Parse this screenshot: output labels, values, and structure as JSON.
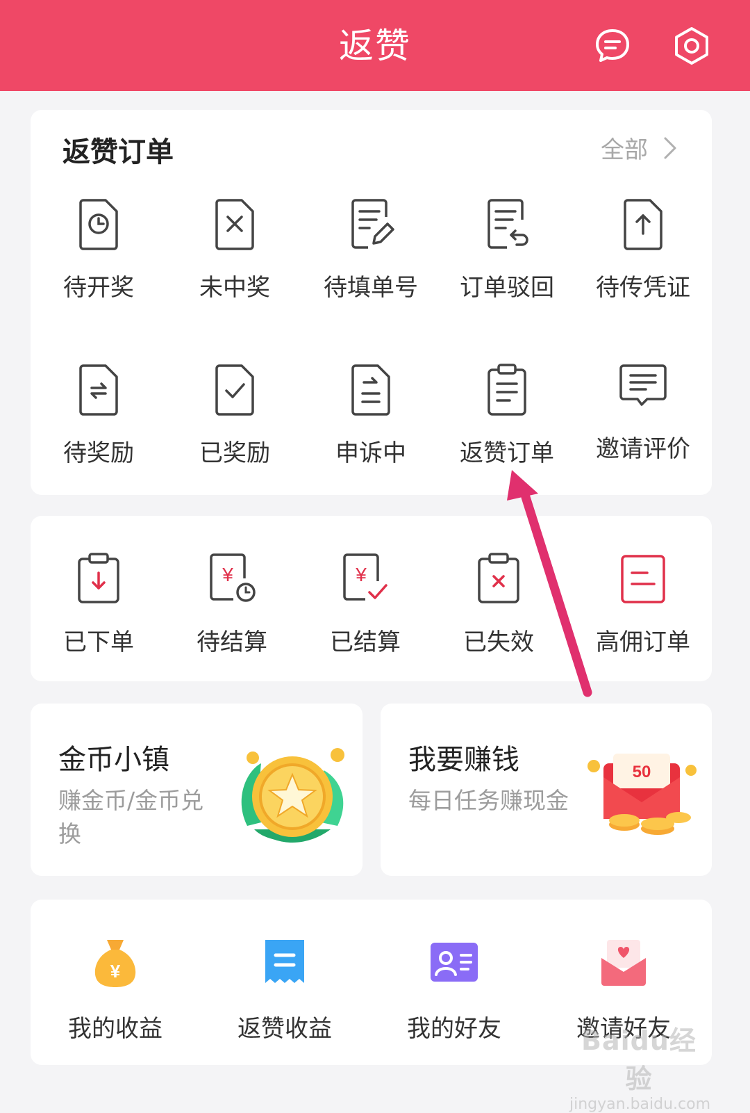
{
  "header": {
    "title": "返赞",
    "accent": "#ef4866"
  },
  "orders_card": {
    "title": "返赞订单",
    "more_label": "全部",
    "items": [
      {
        "label": "待开奖",
        "icon": "doc-clock-icon"
      },
      {
        "label": "未中奖",
        "icon": "doc-x-icon"
      },
      {
        "label": "待填单号",
        "icon": "doc-edit-icon"
      },
      {
        "label": "订单驳回",
        "icon": "doc-return-icon"
      },
      {
        "label": "待传凭证",
        "icon": "doc-upload-icon"
      },
      {
        "label": "待奖励",
        "icon": "doc-exchange-icon"
      },
      {
        "label": "已奖励",
        "icon": "doc-check-icon"
      },
      {
        "label": "申诉中",
        "icon": "doc-arrow-icon"
      },
      {
        "label": "返赞订单",
        "icon": "clipboard-icon"
      },
      {
        "label": "邀请评价",
        "icon": "comment-icon"
      }
    ]
  },
  "commission_card": {
    "items": [
      {
        "label": "已下单",
        "icon": "clipboard-down-icon"
      },
      {
        "label": "待结算",
        "icon": "yen-clock-icon"
      },
      {
        "label": "已结算",
        "icon": "yen-check-icon"
      },
      {
        "label": "已失效",
        "icon": "clipboard-x-icon"
      },
      {
        "label": "高佣订单",
        "icon": "high-commission-icon"
      }
    ]
  },
  "promos": [
    {
      "title": "金币小镇",
      "subtitle": "赚金币/金币兑换",
      "icon": "gold-coin-icon"
    },
    {
      "title": "我要赚钱",
      "subtitle": "每日任务赚现金",
      "icon": "red-envelope-icon",
      "badge": "50"
    }
  ],
  "bottom_menu": [
    {
      "label": "我的收益",
      "icon": "money-bag-icon"
    },
    {
      "label": "返赞收益",
      "icon": "receipt-icon"
    },
    {
      "label": "我的好友",
      "icon": "contact-card-icon"
    },
    {
      "label": "邀请好友",
      "icon": "invite-envelope-icon"
    }
  ],
  "watermark": {
    "brand": "Baidu经验",
    "url": "jingyan.baidu.com"
  },
  "colors": {
    "annotation_arrow": "#e0306e"
  }
}
